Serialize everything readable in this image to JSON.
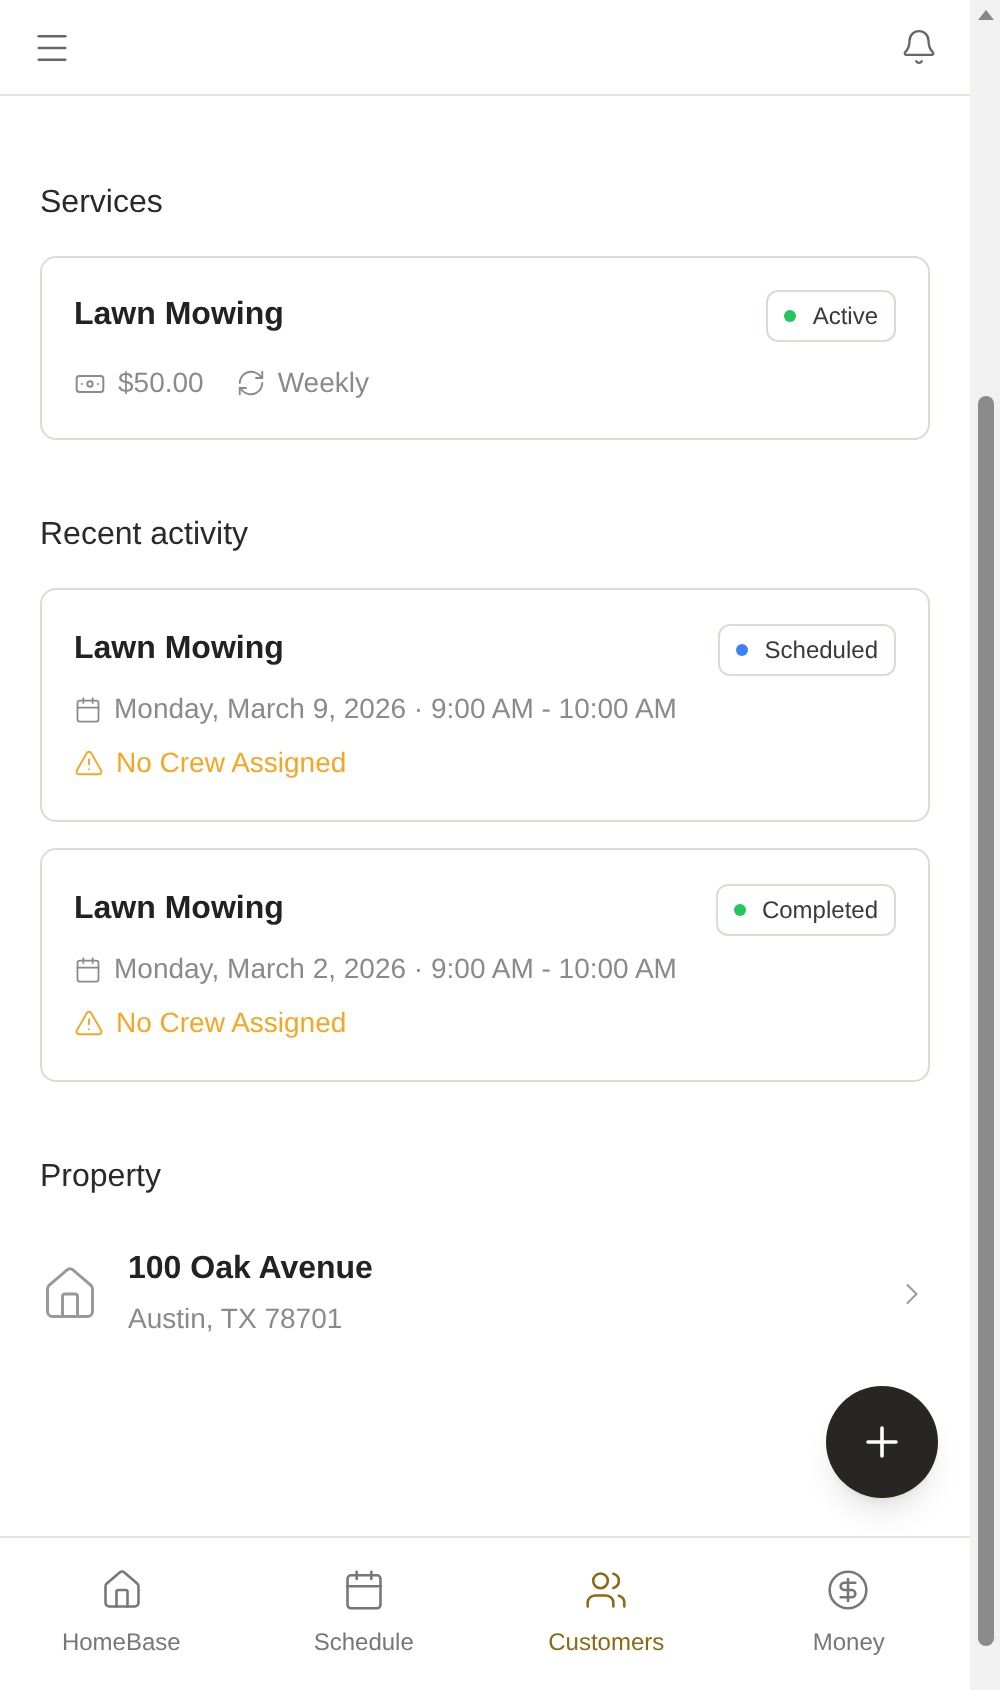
{
  "services": {
    "title": "Services",
    "items": [
      {
        "name": "Lawn Mowing",
        "status": "Active",
        "color": "#22c55e",
        "price": "$50.00",
        "frequency": "Weekly"
      }
    ]
  },
  "recent_activity": {
    "title": "Recent activity",
    "items": [
      {
        "name": "Lawn Mowing",
        "status": "Scheduled",
        "color": "#3b82f6",
        "when": "Monday, March 9, 2026 · 9:00 AM - 10:00 AM",
        "warning": "No Crew Assigned"
      },
      {
        "name": "Lawn Mowing",
        "status": "Completed",
        "color": "#22c55e",
        "when": "Monday, March 2, 2026 · 9:00 AM - 10:00 AM",
        "warning": "No Crew Assigned"
      }
    ]
  },
  "property": {
    "title": "Property",
    "address": "100 Oak Avenue",
    "city": "Austin, TX 78701"
  },
  "bottom_nav": [
    {
      "label": "HomeBase",
      "kind": "home",
      "selected": false
    },
    {
      "label": "Schedule",
      "kind": "calendar",
      "selected": false
    },
    {
      "label": "Customers",
      "kind": "people",
      "selected": true
    },
    {
      "label": "Money",
      "kind": "dollar",
      "selected": false
    }
  ]
}
